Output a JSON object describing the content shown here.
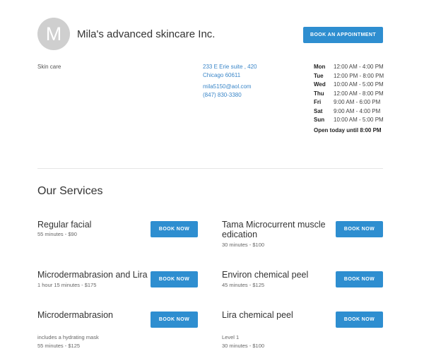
{
  "business": {
    "avatar_letter": "M",
    "name": "Mila's advanced skincare Inc.",
    "book_label": "BOOK AN APPOINTMENT",
    "category": "Skin care",
    "address_line1": "233 E Erie suite , 420",
    "address_line2": "Chicago 60611",
    "email": "mila5150@aol.com",
    "phone": "(847) 830-3380",
    "open_today": "Open today until 8:00 PM"
  },
  "hours": [
    {
      "day": "Mon",
      "time": "12:00 AM - 4:00 PM"
    },
    {
      "day": "Tue",
      "time": "12:00 PM - 8:00 PM"
    },
    {
      "day": "Wed",
      "time": "10:00 AM - 5:00 PM"
    },
    {
      "day": "Thu",
      "time": "12:00 AM - 8:00 PM"
    },
    {
      "day": "Fri",
      "time": "9:00 AM - 6:00 PM"
    },
    {
      "day": "Sat",
      "time": "9:00 AM - 4:00 PM"
    },
    {
      "day": "Sun",
      "time": "10:00 AM - 5:00 PM"
    }
  ],
  "services_title": "Our Services",
  "book_now_label": "BOOK NOW",
  "services": [
    {
      "name": "Regular facial",
      "meta": "55 minutes - $90"
    },
    {
      "name_line1": "Tama Microcurrent muscle",
      "name_line2": "edication",
      "meta": "30 minutes - $100"
    },
    {
      "name": "Microdermabrasion and Lira",
      "meta": "1 hour 15 minutes - $175"
    },
    {
      "name": "Environ chemical peel",
      "meta": "45 minutes - $125"
    },
    {
      "name": "Microdermabrasion",
      "note": "includes a hydrating mask",
      "meta": "55 minutes - $125"
    },
    {
      "name": "Lira chemical peel",
      "note": "Level 1",
      "meta": "30 minutes - $100"
    }
  ]
}
